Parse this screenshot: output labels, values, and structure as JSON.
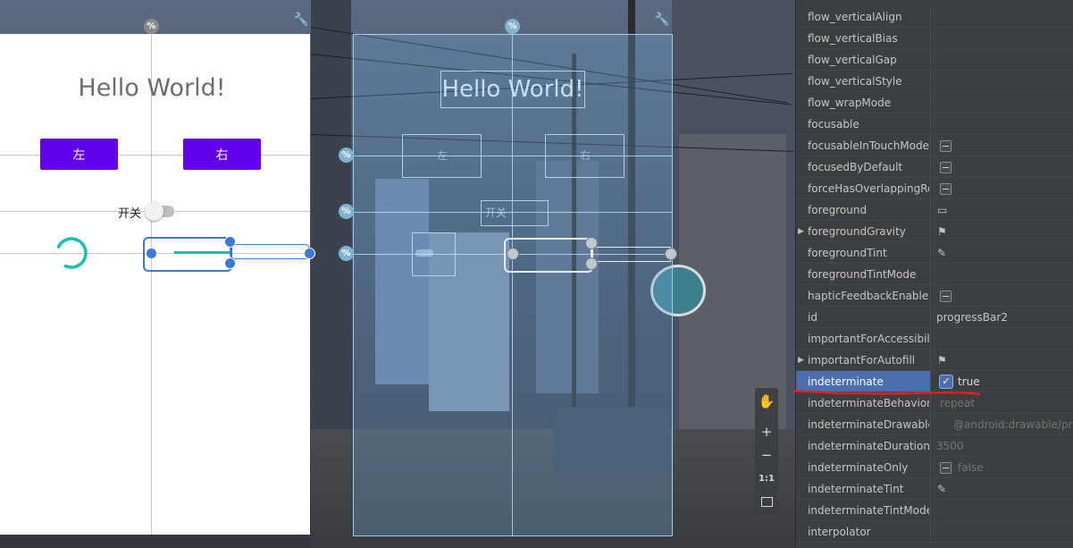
{
  "design": {
    "hello_text": "Hello World!",
    "left_button": "左",
    "right_button": "右",
    "switch_label": "开关",
    "switch_on": false
  },
  "blueprint": {
    "hello_text": "Hello World!",
    "left_button": "左",
    "right_button": "右",
    "switch_label": "开关"
  },
  "markers": {
    "percent": "%"
  },
  "zoom_toolbar": {
    "pan_icon": "hand-icon",
    "zoom_in": "+",
    "zoom_out": "−",
    "actual_size": "1:1",
    "fit_icon": "fit-screen-icon"
  },
  "attributes": [
    {
      "name": "flow_verticalAlign",
      "value": ""
    },
    {
      "name": "flow_verticalBias",
      "value": ""
    },
    {
      "name": "flow_verticalGap",
      "value": ""
    },
    {
      "name": "flow_verticalStyle",
      "value": ""
    },
    {
      "name": "flow_wrapMode",
      "value": ""
    },
    {
      "name": "focusable",
      "value": ""
    },
    {
      "name": "focusableInTouchMode",
      "value": "",
      "icon": "minus-box-icon"
    },
    {
      "name": "focusedByDefault",
      "value": "",
      "icon": "minus-box-icon"
    },
    {
      "name": "forceHasOverlappingRe...",
      "value": "",
      "icon": "minus-box-icon"
    },
    {
      "name": "foreground",
      "value": "",
      "icon": "image-icon"
    },
    {
      "name": "foregroundGravity",
      "value": "",
      "icon": "flag-icon",
      "expandable": true
    },
    {
      "name": "foregroundTint",
      "value": "",
      "icon": "eyedropper-icon"
    },
    {
      "name": "foregroundTintMode",
      "value": ""
    },
    {
      "name": "hapticFeedbackEnabled",
      "value": "",
      "icon": "minus-box-icon"
    },
    {
      "name": "id",
      "value": "progressBar2"
    },
    {
      "name": "importantForAccessibility",
      "value": ""
    },
    {
      "name": "importantForAutofill",
      "value": "",
      "icon": "flag-icon",
      "expandable": true
    },
    {
      "name": "indeterminate",
      "value": "true",
      "checked": true,
      "selected": true
    },
    {
      "name": "indeterminateBehavior",
      "value": "repeat",
      "dim": true
    },
    {
      "name": "indeterminateDrawable",
      "value": "@android:drawable/pr",
      "dim": true
    },
    {
      "name": "indeterminateDuration",
      "value": "3500",
      "dim": true
    },
    {
      "name": "indeterminateOnly",
      "value": "false",
      "icon": "minus-box-icon",
      "dim": true
    },
    {
      "name": "indeterminateTint",
      "value": "",
      "icon": "eyedropper-icon"
    },
    {
      "name": "indeterminateTintMode",
      "value": ""
    },
    {
      "name": "interpolator",
      "value": ""
    }
  ],
  "colors": {
    "accent_purple": "#6200ee",
    "progress_teal": "#14c2b4",
    "selection_blue": "#3b78d8",
    "attr_selected": "#4b6eaf",
    "annotation_red": "#e02020"
  }
}
